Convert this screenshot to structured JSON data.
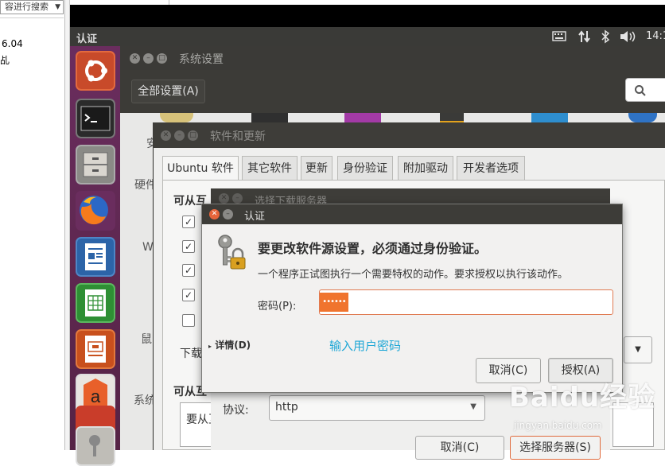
{
  "host": {
    "search_text": "容进行搜索",
    "left_line1": "6.04",
    "left_line2": "乩"
  },
  "topbar": {
    "title": "认证",
    "clock": "14:1"
  },
  "settings": {
    "title": "系统设置",
    "all_settings": "全部设置(A)",
    "side_labels": [
      "安",
      "硬件",
      "W",
      "鼠",
      "系统"
    ]
  },
  "software_updates": {
    "title": "软件和更新",
    "tabs": [
      "Ubuntu 软件",
      "其它软件",
      "更新",
      "身份验证",
      "附加驱动",
      "开发者选项"
    ],
    "available_label": "可从互",
    "download_label": "下载",
    "available_label2": "可从互",
    "bottom_text": "要从互"
  },
  "server_dialog": {
    "title": "选择下载服务器",
    "protocol_label": "协议:",
    "protocol_value": "http",
    "cancel": "取消(C)",
    "choose": "选择服务器(S)"
  },
  "auth_dialog": {
    "title": "认证",
    "heading": "要更改软件源设置，必须通过身份验证。",
    "message": "一个程序正试图执行一个需要特权的动作。要求授权以执行该动作。",
    "password_label": "密码(P):",
    "password_mask": "••••••",
    "details": "详情(D)",
    "cancel": "取消(C)",
    "authorize": "授权(A)"
  },
  "annotation": "输入用户密码",
  "watermark": {
    "brand": "Baidu经验",
    "url": "jingyan.baidu.com"
  },
  "colors": {
    "launcher": "#5e2750",
    "accent": "#f0742e",
    "annotation": "#1ea7d6"
  }
}
